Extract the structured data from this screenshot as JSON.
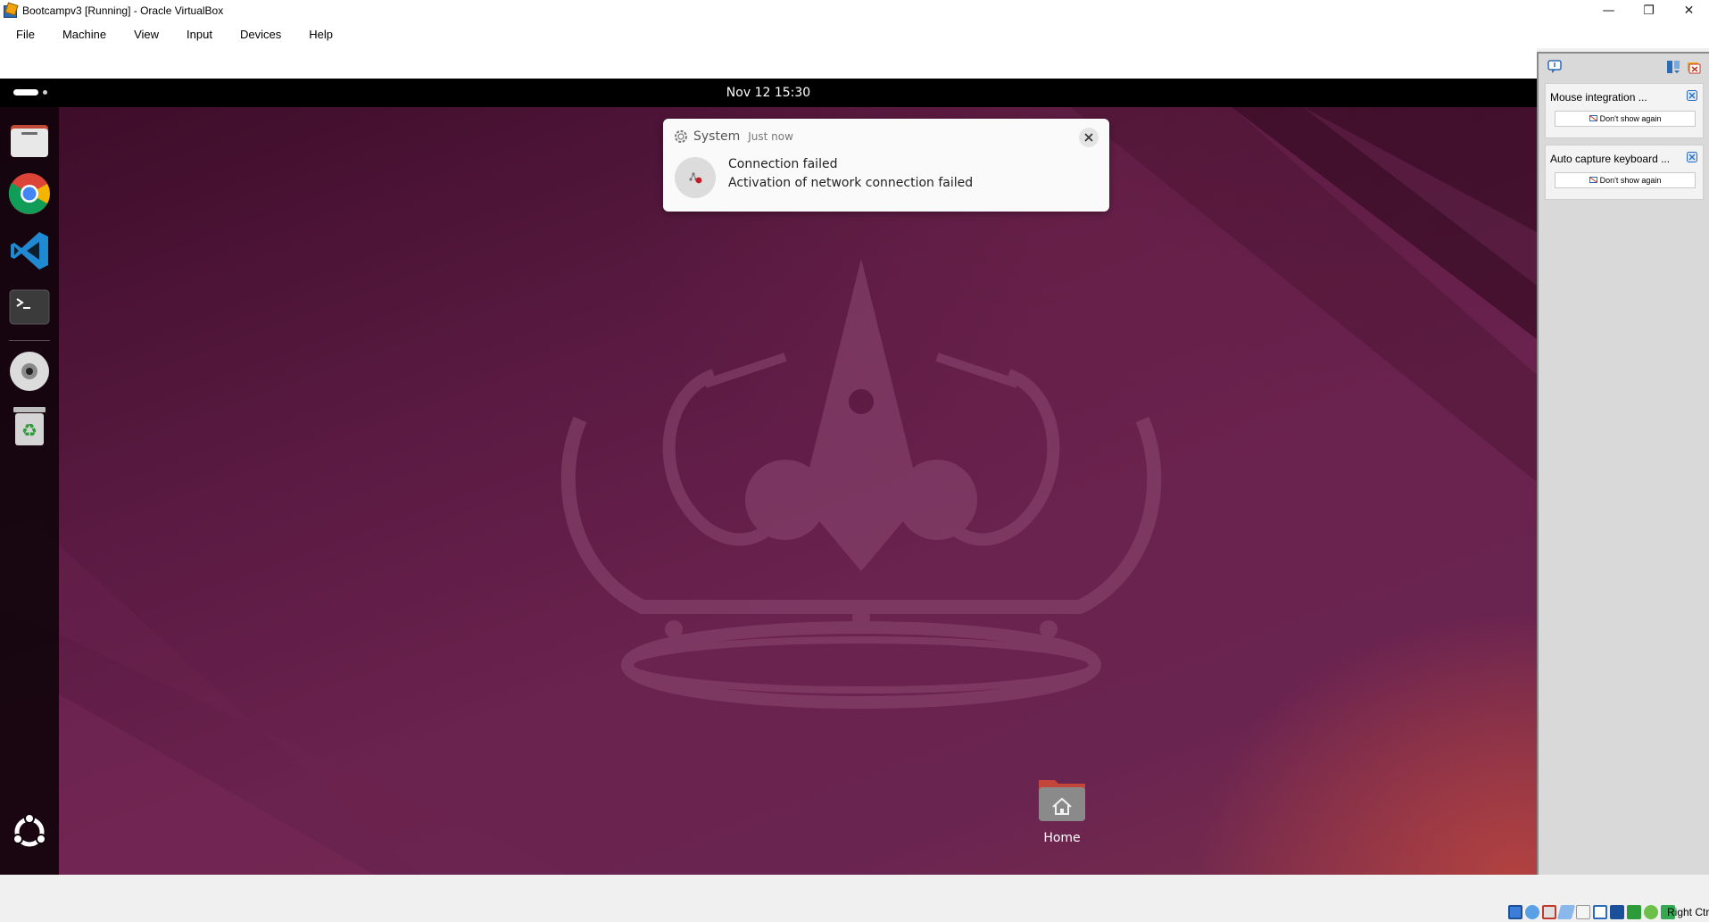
{
  "window": {
    "title": "Bootcampv3 [Running] - Oracle VirtualBox",
    "minimize": "—",
    "restore": "❐",
    "close": "✕"
  },
  "menu": [
    "File",
    "Machine",
    "View",
    "Input",
    "Devices",
    "Help"
  ],
  "guest": {
    "topbar": {
      "clock": "Nov 12  15:30"
    },
    "dock_apps": [
      "files-icon",
      "chrome-icon",
      "vscode-icon",
      "terminal-icon",
      "dvd-icon",
      "trash-icon"
    ],
    "notification": {
      "source": "System",
      "time": "Just now",
      "title": "Connection failed",
      "body": "Activation of network connection failed"
    },
    "desktop_items": [
      {
        "label": "Home"
      }
    ]
  },
  "vbox_notifications": [
    {
      "title": "Mouse integration ...",
      "button": "Don't show again"
    },
    {
      "title": "Auto capture keyboard ...",
      "button": "Don't show again"
    }
  ],
  "statusbar": {
    "host_key": "Right Ctrl"
  },
  "colors": {
    "ubuntu_topbar": "#000000",
    "dock": "#12040c",
    "wallpaper_base": "#5a1a42",
    "accent_orange": "#e95420"
  }
}
